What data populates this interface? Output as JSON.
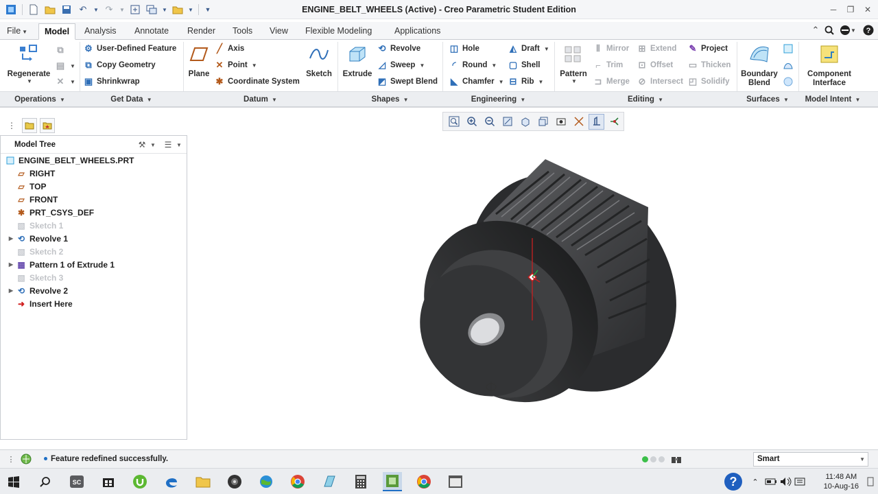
{
  "window": {
    "title": "ENGINE_BELT_WHEELS (Active) - Creo Parametric Student Edition"
  },
  "tabs": [
    {
      "label": "File"
    },
    {
      "label": "Model"
    },
    {
      "label": "Analysis"
    },
    {
      "label": "Annotate"
    },
    {
      "label": "Render"
    },
    {
      "label": "Tools"
    },
    {
      "label": "View"
    },
    {
      "label": "Flexible Modeling"
    },
    {
      "label": "Applications"
    }
  ],
  "ribbon": {
    "regenerate": "Regenerate",
    "get_data": {
      "user_defined_feature": "User-Defined Feature",
      "copy_geometry": "Copy Geometry",
      "shrinkwrap": "Shrinkwrap"
    },
    "datum": {
      "plane": "Plane",
      "axis": "Axis",
      "point": "Point",
      "coordinate_system": "Coordinate System",
      "sketch": "Sketch"
    },
    "shapes": {
      "extrude": "Extrude",
      "revolve": "Revolve",
      "sweep": "Sweep",
      "swept_blend": "Swept Blend"
    },
    "engineering": {
      "hole": "Hole",
      "round": "Round",
      "chamfer": "Chamfer",
      "draft": "Draft",
      "shell": "Shell",
      "rib": "Rib"
    },
    "editing": {
      "pattern": "Pattern",
      "mirror": "Mirror",
      "trim": "Trim",
      "merge": "Merge",
      "extend": "Extend",
      "offset": "Offset",
      "intersect": "Intersect",
      "project": "Project",
      "thicken": "Thicken",
      "solidify": "Solidify"
    },
    "surfaces": {
      "boundary_blend": "Boundary Blend"
    },
    "model_intent": {
      "component_interface": "Component Interface"
    },
    "groups": [
      {
        "label": "Operations"
      },
      {
        "label": "Get Data"
      },
      {
        "label": "Datum"
      },
      {
        "label": "Shapes"
      },
      {
        "label": "Engineering"
      },
      {
        "label": "Editing"
      },
      {
        "label": "Surfaces"
      },
      {
        "label": "Model Intent"
      }
    ]
  },
  "model_tree": {
    "title": "Model Tree",
    "items": [
      {
        "label": "ENGINE_BELT_WHEELS.PRT",
        "icon": "part-icon"
      },
      {
        "label": "RIGHT",
        "icon": "datum-plane-icon"
      },
      {
        "label": "TOP",
        "icon": "datum-plane-icon"
      },
      {
        "label": "FRONT",
        "icon": "datum-plane-icon"
      },
      {
        "label": "PRT_CSYS_DEF",
        "icon": "coordinate-system-icon"
      },
      {
        "label": "Sketch 1",
        "icon": "sketch-icon"
      },
      {
        "label": "Revolve 1",
        "icon": "revolve-icon"
      },
      {
        "label": "Sketch 2",
        "icon": "sketch-icon"
      },
      {
        "label": "Pattern 1 of Extrude 1",
        "icon": "pattern-icon"
      },
      {
        "label": "Sketch 3",
        "icon": "sketch-icon"
      },
      {
        "label": "Revolve 2",
        "icon": "revolve-icon"
      },
      {
        "label": "Insert Here",
        "icon": "insert-arrow-icon"
      }
    ]
  },
  "status": {
    "message": "Feature redefined successfully.",
    "selection_filter": "Smart"
  },
  "taskbar": {
    "time": "11:48 AM",
    "date": "10-Aug-16"
  },
  "colors": {
    "accent": "#1f6fc5",
    "part_gray": "#4a4b4e"
  }
}
